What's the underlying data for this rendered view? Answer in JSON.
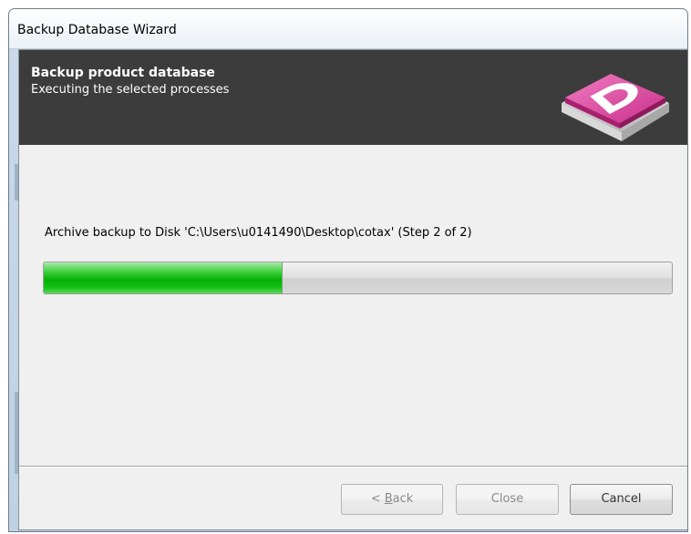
{
  "window": {
    "title": "Backup Database Wizard"
  },
  "header": {
    "title": "Backup product database",
    "subtitle": "Executing the selected processes",
    "logo_icon": "database-d-icon",
    "logo_color": "#d84aa0"
  },
  "progress": {
    "status_text": "Archive backup to Disk 'C:\\Users\\u0141490\\Desktop\\cotax' (Step 2 of 2)",
    "fraction": 0.38,
    "fill_color": "#06b106"
  },
  "buttons": {
    "back_prefix": "< ",
    "back_accel": "B",
    "back_rest": "ack",
    "close_label": "Close",
    "cancel_label": "Cancel"
  }
}
